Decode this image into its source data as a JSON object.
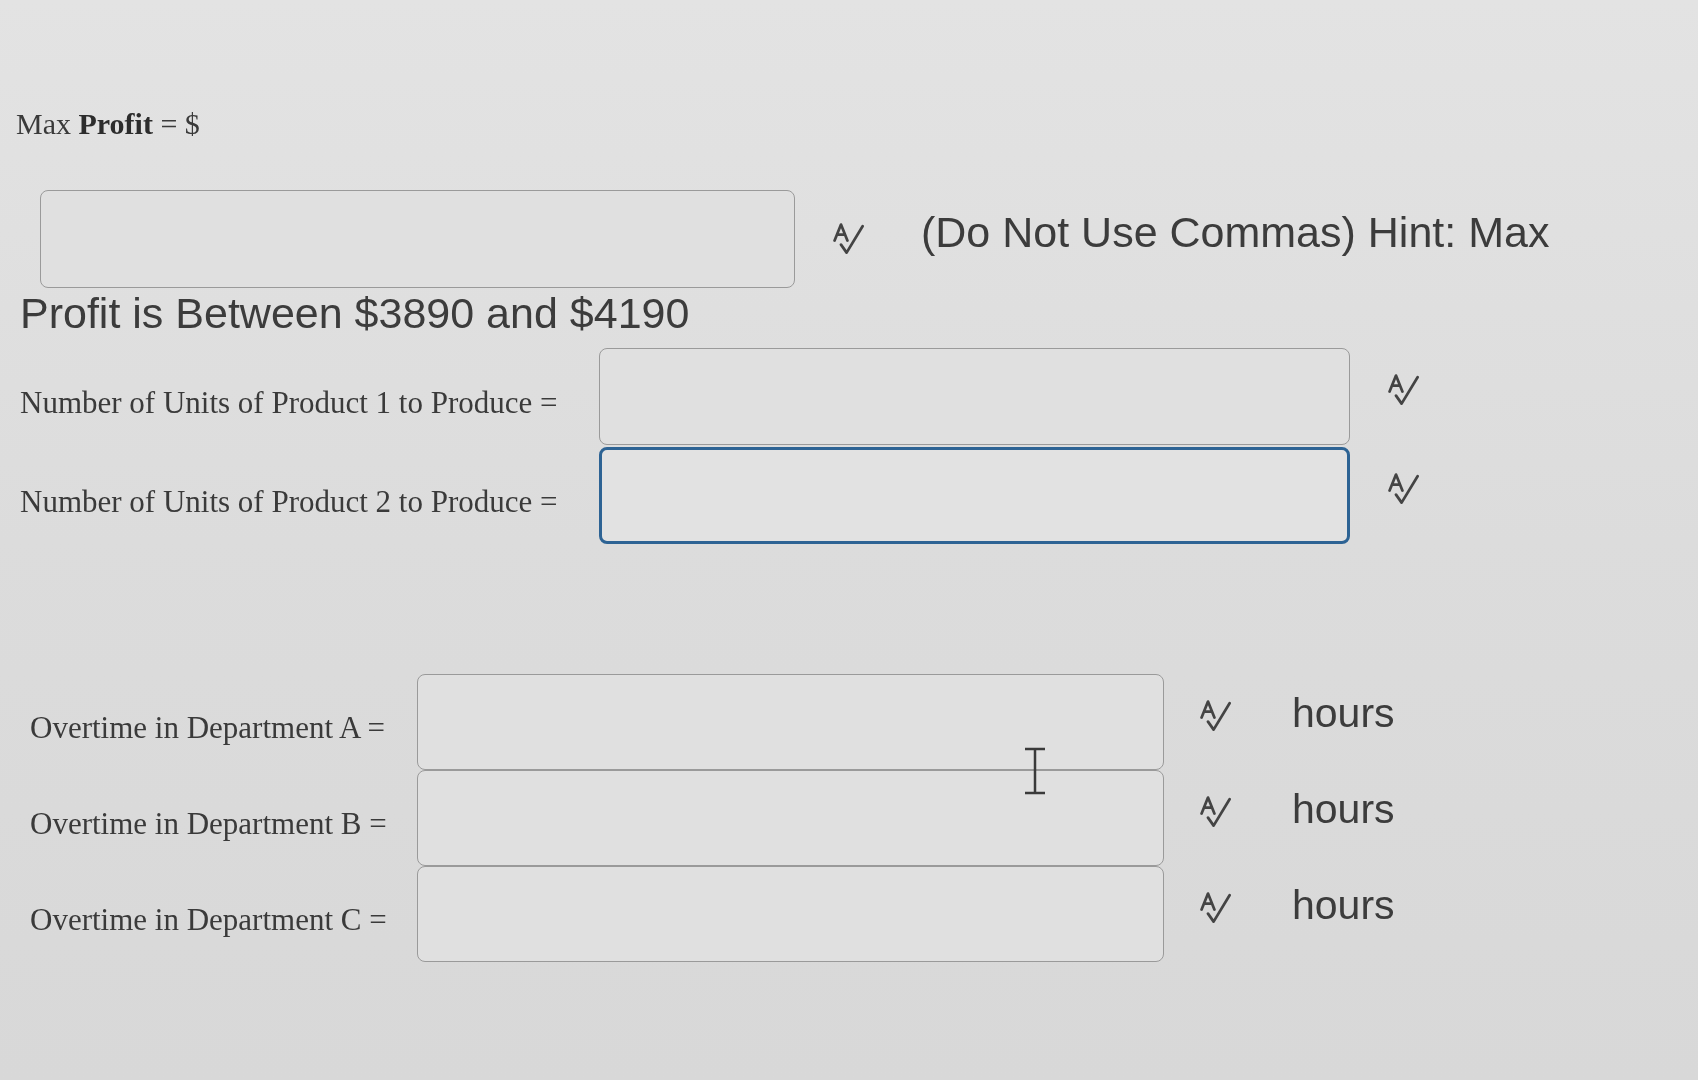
{
  "max_profit": {
    "label": "Max **Profit** = $",
    "focused": false,
    "hint": [
      "(Do Not Use Commas) Hint: Max",
      "Profit is Between $3890 and $4190"
    ]
  },
  "products": [
    {
      "label": "Number of Units of Product 1 to Produce =",
      "focused": false
    },
    {
      "label": "Number of Units of Product 2 to Produce =",
      "focused": true
    }
  ],
  "overtime": [
    {
      "label": "Overtime in Department A =",
      "focused": false,
      "unit": "hours"
    },
    {
      "label": "Overtime in Department B =",
      "focused": false,
      "unit": "hours"
    },
    {
      "label": "Overtime in Department C =",
      "focused": false,
      "unit": "hours"
    }
  ]
}
